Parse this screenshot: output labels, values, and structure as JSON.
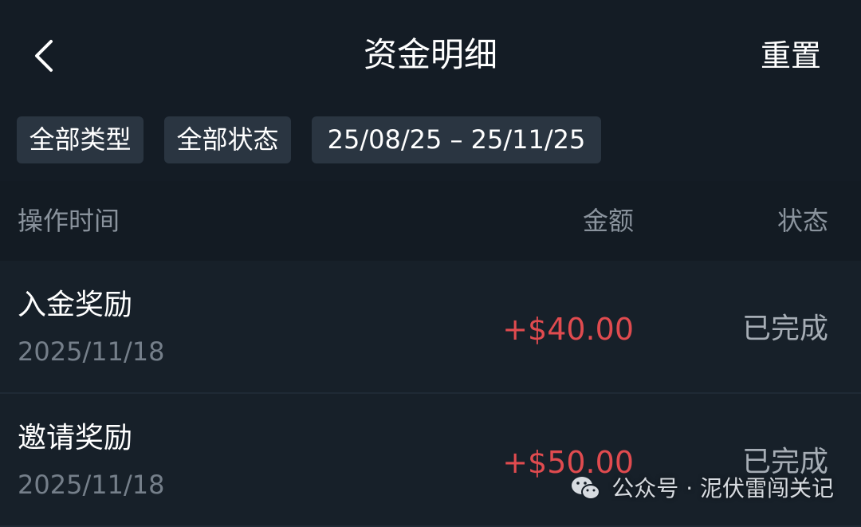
{
  "header": {
    "back_icon": "chevron-left-icon",
    "title": "资金明细",
    "reset_label": "重置"
  },
  "filters": {
    "type_label": "全部类型",
    "status_label": "全部状态",
    "date_range": "25/08/25 – 25/11/25"
  },
  "table": {
    "columns": {
      "time": "操作时间",
      "amount": "金额",
      "status": "状态"
    },
    "rows": [
      {
        "type": "入金奖励",
        "date": "2025/11/18",
        "amount": "+$40.00",
        "status": "已完成"
      },
      {
        "type": "邀请奖励",
        "date": "2025/11/18",
        "amount": "+$50.00",
        "status": "已完成"
      }
    ]
  },
  "watermark": {
    "icon": "wechat-icon",
    "text": "公众号 · 泥伏雷闯关记"
  },
  "colors": {
    "background": "#141c25",
    "chip": "#2a3541",
    "amount": "#e04b4f",
    "muted": "#8a939d"
  }
}
